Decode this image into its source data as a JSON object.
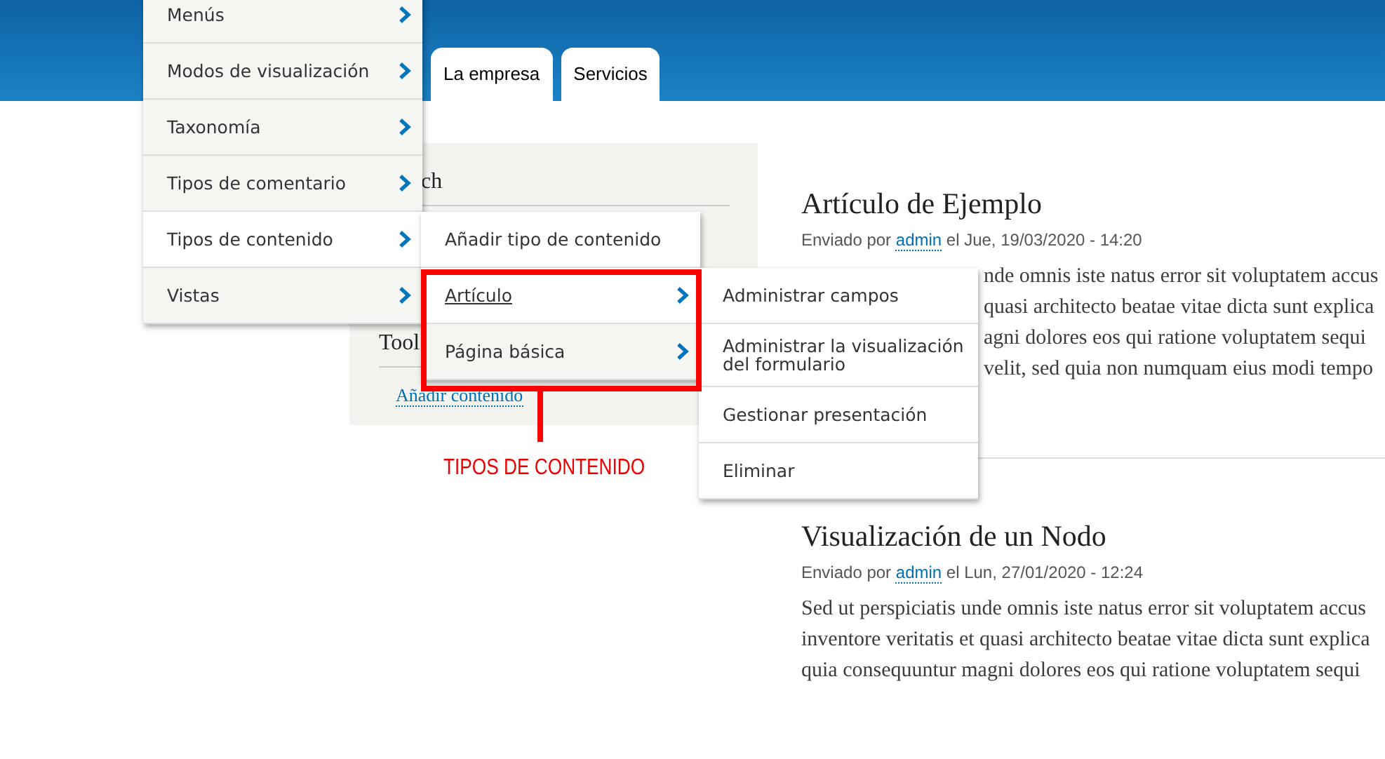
{
  "header": {
    "tabs": [
      {
        "label": "La empresa",
        "selected": false
      },
      {
        "label": "Servicios",
        "selected": false
      }
    ]
  },
  "sidebar": {
    "blocks": [
      {
        "title": "ch",
        "partly_hidden": true
      },
      {
        "title": "Tool",
        "partly_hidden": false,
        "links": [
          "Añadir contenido"
        ]
      }
    ]
  },
  "articles": [
    {
      "title": "Artículo de Ejemplo",
      "partly_hidden": true,
      "meta": {
        "prefix": "Enviado por",
        "author": "admin",
        "suffix": "el Jue, 19/03/2020 - 14:20"
      },
      "lines": [
        "nde omnis iste natus error sit voluptatem accus",
        "quasi architecto beatae vitae dicta sunt explica",
        "agni dolores eos qui ratione voluptatem sequi",
        "velit, sed quia non numquam eius modi tempo"
      ]
    },
    {
      "title": "Visualización de un Nodo",
      "partly_hidden": false,
      "meta": {
        "prefix": "Enviado por",
        "author": "admin",
        "suffix": "el Lun, 27/01/2020 - 12:24"
      },
      "lines": [
        "Sed ut perspiciatis unde omnis iste natus error sit voluptatem accus",
        "inventore veritatis et quasi architecto beatae vitae dicta sunt explica",
        "quia consequuntur magni dolores eos qui ratione voluptatem sequi"
      ]
    }
  ],
  "admin_menu": {
    "items": [
      {
        "label": "Menús",
        "arrow": true,
        "expanded": false,
        "focused": false
      },
      {
        "label": "Modos de visualización",
        "arrow": true,
        "expanded": false,
        "focused": false
      },
      {
        "label": "Taxonomía",
        "arrow": true,
        "expanded": false,
        "focused": false
      },
      {
        "label": "Tipos de comentario",
        "arrow": true,
        "expanded": false,
        "focused": false
      },
      {
        "label": "Tipos de contenido",
        "arrow": true,
        "expanded": true,
        "focused": false,
        "children": [
          {
            "label": "Añadir tipo de contenido",
            "arrow": false,
            "expanded": false,
            "focused": false
          },
          {
            "label": "Artículo",
            "arrow": true,
            "expanded": true,
            "focused": true,
            "children": [
              {
                "label": "Administrar campos",
                "arrow": false,
                "expanded": false,
                "focused": false
              },
              {
                "label": "Administrar la visualización del formulario",
                "arrow": false,
                "expanded": false,
                "focused": false
              },
              {
                "label": "Gestionar presentación",
                "arrow": false,
                "expanded": false,
                "focused": false
              },
              {
                "label": "Eliminar",
                "arrow": false,
                "expanded": false,
                "focused": false
              }
            ]
          },
          {
            "label": "Página básica",
            "arrow": true,
            "expanded": false,
            "focused": false
          }
        ]
      },
      {
        "label": "Vistas",
        "arrow": true,
        "expanded": false,
        "focused": false
      }
    ]
  },
  "annotation": {
    "label": "TIPOS DE CONTENIDO"
  }
}
